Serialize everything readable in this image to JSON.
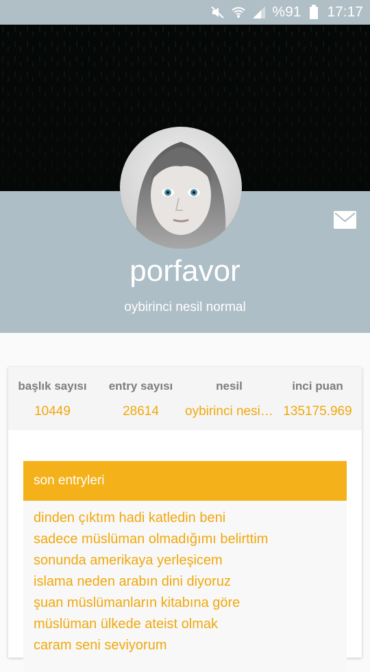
{
  "status_bar": {
    "battery": "%91",
    "time": "17:17",
    "icons": [
      "mute-icon",
      "wifi-icon",
      "signal-icon",
      "battery-icon"
    ]
  },
  "profile": {
    "username": "porfavor",
    "subtitle": "oybirinci nesil normal"
  },
  "stats": [
    {
      "label": "başlık sayısı",
      "value": "10449"
    },
    {
      "label": "entry sayısı",
      "value": "28614"
    },
    {
      "label": "nesil",
      "value": "oybirinci nesil normal"
    },
    {
      "label": "inci puan",
      "value": "135175.969"
    }
  ],
  "recent_entries": {
    "title": "son entryleri",
    "items": [
      "dinden çıktım hadi katledin beni",
      "sadece müslüman olmadığımı belirttim",
      "sonunda amerikaya yerleşicem",
      "islama neden arabın dini diyoruz",
      "şuan müslümanların kitabına göre",
      "müslüman ülkede ateist olmak",
      "caram seni seviyorum"
    ]
  },
  "colors": {
    "accent": "#f4b11a",
    "accent_text": "#f0a80d",
    "profile_band": "#aebec6",
    "status_bar": "#b0bec5"
  }
}
